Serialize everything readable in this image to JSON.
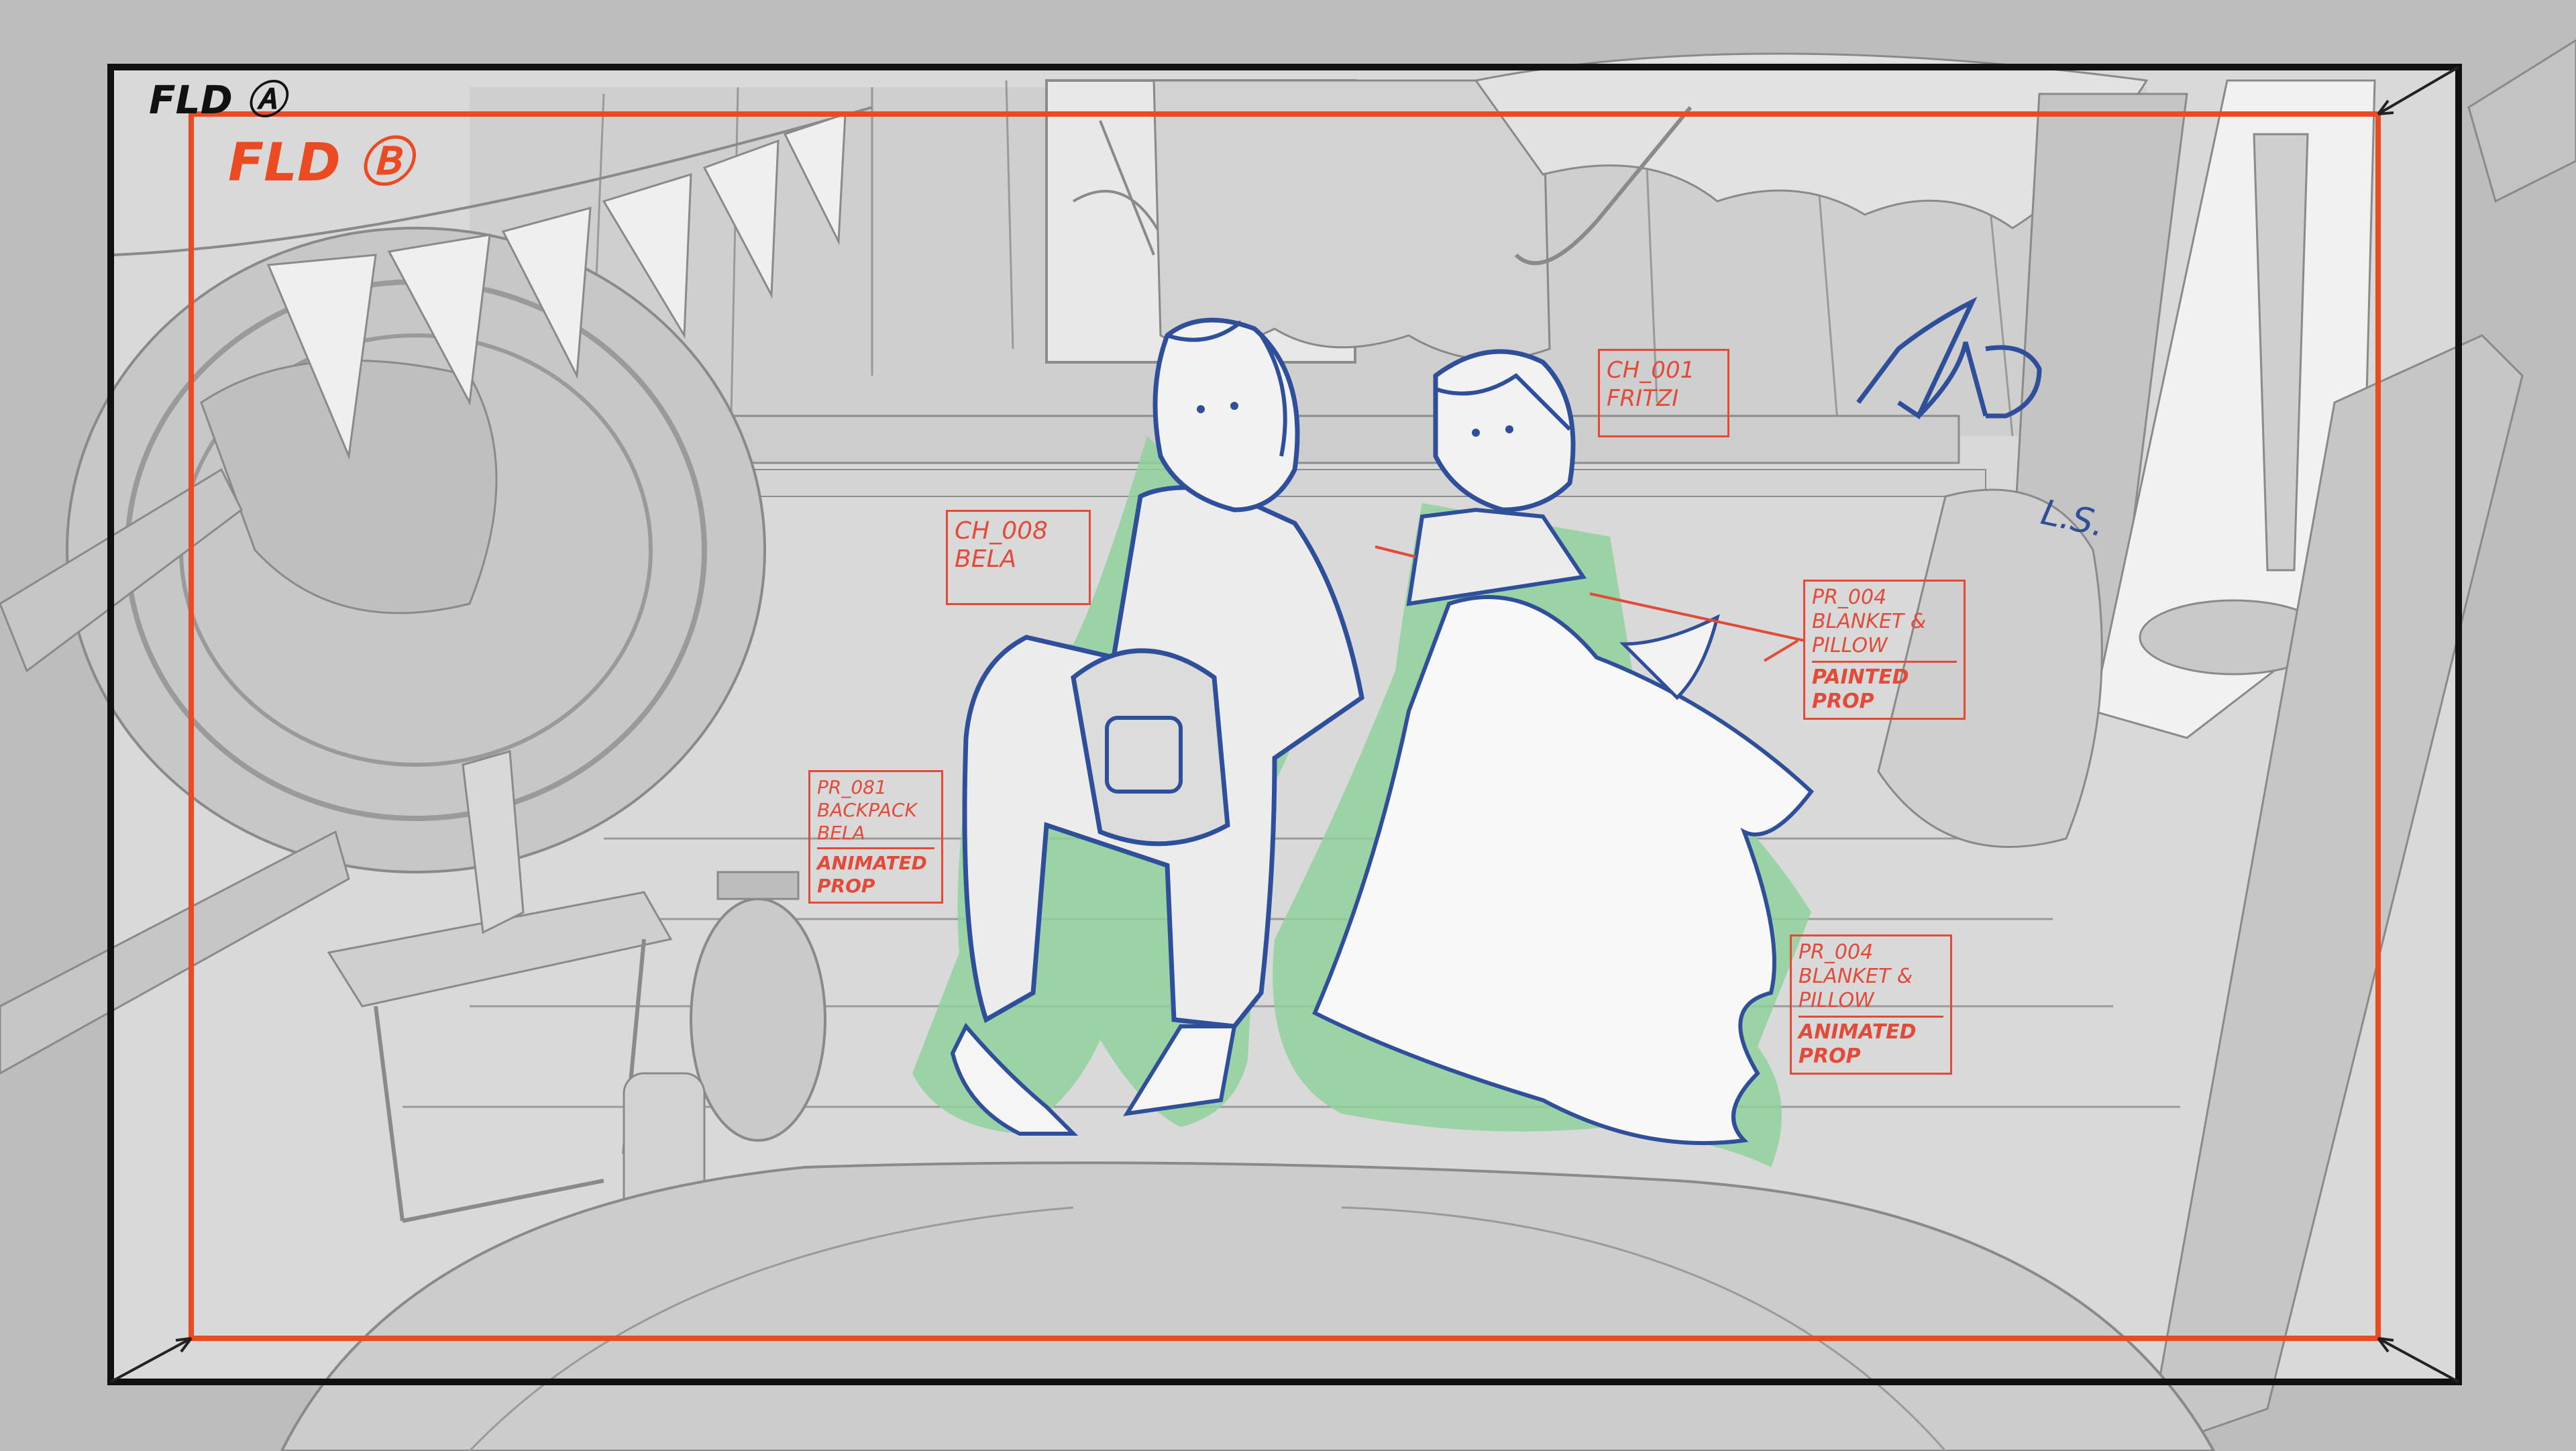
{
  "field_guides": {
    "field_a_label": "FLD Ⓐ",
    "field_b_label": "FLD Ⓑ"
  },
  "annotations": [
    {
      "id": "ch008",
      "lines": [
        "CH_008",
        "BELA"
      ]
    },
    {
      "id": "ch001",
      "lines": [
        "CH_001",
        "FRITZI"
      ]
    },
    {
      "id": "pr004a",
      "lines": [
        "PR_004",
        "BLANKET &",
        "PILLOW"
      ],
      "tag": [
        "PAINTED",
        "PROP"
      ]
    },
    {
      "id": "pr081",
      "lines": [
        "PR_081",
        "BACKPACK",
        "BELA"
      ],
      "tag": [
        "ANIMATED",
        "PROP"
      ]
    },
    {
      "id": "pr004b",
      "lines": [
        "PR_004",
        "BLANKET &",
        "PILLOW"
      ],
      "tag": [
        "ANIMATED",
        "PROP"
      ]
    }
  ],
  "director_mark": {
    "initials": "L.S."
  },
  "colors": {
    "field_a": "#111111",
    "field_b": "#ea4b22",
    "annotation": "#e24a3a",
    "character_shadow": "#8fd19e",
    "character_line": "#2f4f9a",
    "background_line": "#8a8a8a"
  }
}
